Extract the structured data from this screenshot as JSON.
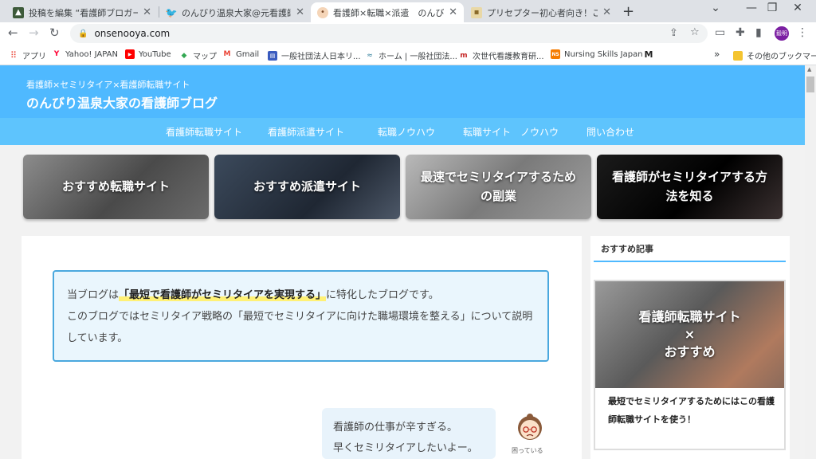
{
  "browser": {
    "tabs": [
      {
        "title": "投稿を編集 “看護師ブロガー大集合",
        "icon": "tab-favicon-landscape"
      },
      {
        "title": "のんびり温泉大家@元看護師リタイ",
        "icon": "twitter-icon"
      },
      {
        "title": "看護師×転職×派遣　のんびり温泉",
        "icon": "tab-favicon-avatar"
      },
      {
        "title": "プリセプター初心者向き！こうすれば",
        "icon": "tab-favicon-page"
      }
    ],
    "url": "onsenooya.com",
    "profile_label": "毅明",
    "bookmarks": [
      "アプリ",
      "Yahoo! JAPAN",
      "YouTube",
      "マップ",
      "Gmail",
      "一般社団法人日本リ...",
      "ホーム | 一般社団法...",
      "次世代看護教育研...",
      "Nursing Skills Japan",
      "",
      "その他のブックマーク"
    ],
    "bookmarks_more": "»"
  },
  "site": {
    "subtitle": "看護師×セミリタイア×看護師転職サイト",
    "title": "のんびり温泉大家の看護師ブログ",
    "nav": [
      "看護師転職サイト",
      "看護師派遣サイト",
      "転職ノウハウ",
      "転職サイト　ノウハウ",
      "問い合わせ"
    ]
  },
  "cards": [
    {
      "label": "おすすめ転職サイト"
    },
    {
      "label": "おすすめ派遣サイト"
    },
    {
      "label": "最速でセミリタイアするための副業"
    },
    {
      "label": "看護師がセミリタイアする方法を知る"
    }
  ],
  "main": {
    "intro_pre": "当ブログは",
    "intro_highlight": "「最短で看護師がセミリタイアを実現する」",
    "intro_post": "に特化したブログです。",
    "intro_line2": "このブログではセミリタイア戦略の「最短でセミリタイアに向けた職場環境を整える」について説明しています。",
    "bubble_line1": "看護師の仕事が辛すぎる。",
    "bubble_line2": "早くセミリタイアしたいよー。",
    "avatar_caption": "困っている"
  },
  "sidebar": {
    "title": "おすすめ記事",
    "card_image_line1": "看護師転職サイト",
    "card_image_line2": "×",
    "card_image_line3": "おすすめ",
    "card_caption": "最短でセミリタイアするためにはこの看護師転職サイトを使う！"
  }
}
